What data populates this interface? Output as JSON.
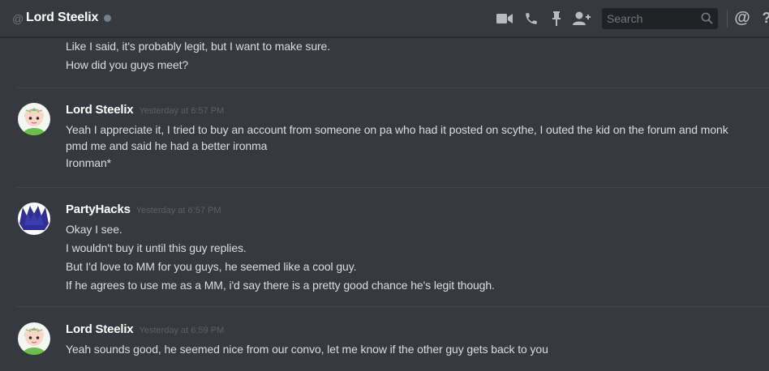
{
  "header": {
    "at_symbol": "@",
    "title": "Lord Steelix",
    "status": "offline",
    "icons": [
      "video-call-icon",
      "phone-call-icon",
      "pin-icon",
      "add-friend-icon",
      "mention-icon",
      "help-icon"
    ],
    "search": {
      "placeholder": "Search",
      "value": ""
    },
    "mention_glyph": "@",
    "help_glyph": "?"
  },
  "messages": {
    "group0": {
      "lines": [
        "Like I said, it's probably legit, but I want to make sure.",
        "How did you guys meet?"
      ]
    },
    "group1": {
      "author": "Lord Steelix",
      "timestamp": "Yesterday at 6:57 PM",
      "lines": [
        "Yeah I appreciate it, I tried to buy an account from someone on pa who had it posted on scythe, I outed the kid on the forum and monk pmd me and said he had a better ironma",
        "Ironman*"
      ]
    },
    "group2": {
      "author": "PartyHacks",
      "timestamp": "Yesterday at 6:57 PM",
      "lines": [
        "Okay I see.",
        "I wouldn't buy it until this guy replies.",
        "But I'd love to MM for you guys, he seemed like a cool guy.",
        "If he agrees to use me as a MM, i'd say there is a pretty good chance he's legit though."
      ]
    },
    "group3": {
      "author": "Lord Steelix",
      "timestamp": "Yesterday at 6:59 PM",
      "lines": [
        "Yeah sounds good, he seemed nice from our convo, let me know if the other guy gets back to you"
      ]
    }
  },
  "colors": {
    "background": "#36393f",
    "text": "#dcddde",
    "username": "#ffffff",
    "timestamp": "#5d6066",
    "separator": "#42454a",
    "search_bg": "#202225"
  }
}
